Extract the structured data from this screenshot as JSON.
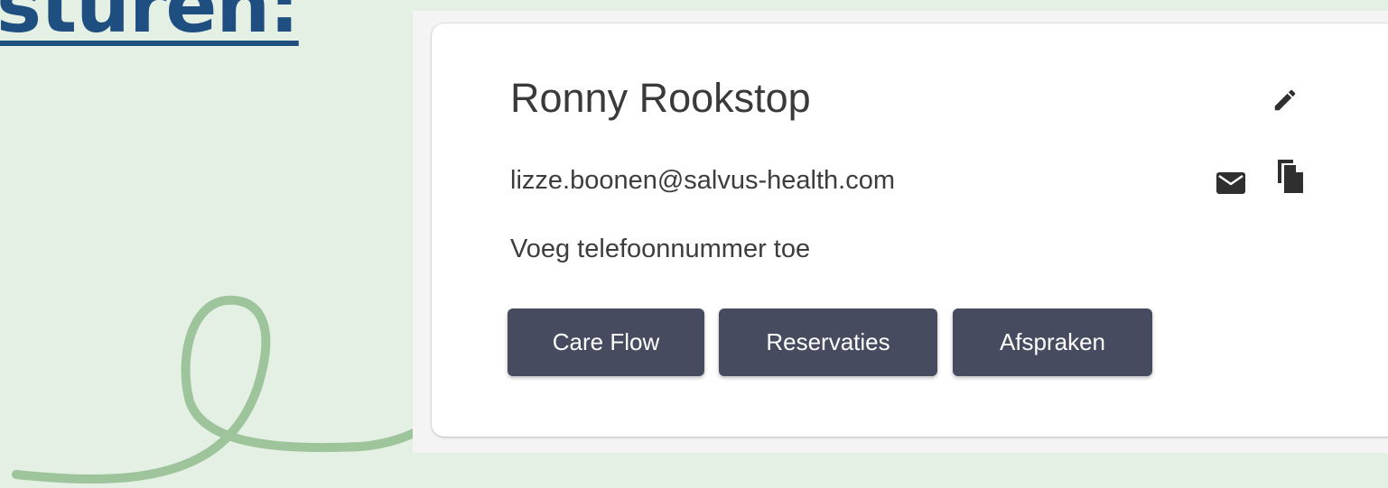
{
  "heading": {
    "text": "sturen:"
  },
  "contact": {
    "name": "Ronny Rookstop",
    "email": "lizze.boonen@salvus-health.com",
    "phone_placeholder": "Voeg telefoonnummer toe"
  },
  "icons": {
    "edit": "pencil-icon",
    "mail": "mail-icon",
    "copy": "copy-icon"
  },
  "buttons": {
    "care_flow": "Care Flow",
    "reservaties": "Reservaties",
    "afspraken": "Afspraken"
  },
  "colors": {
    "background": "#e3f0e3",
    "heading": "#1f4e80",
    "button": "#474b60",
    "arrow": "#9dc49b"
  }
}
